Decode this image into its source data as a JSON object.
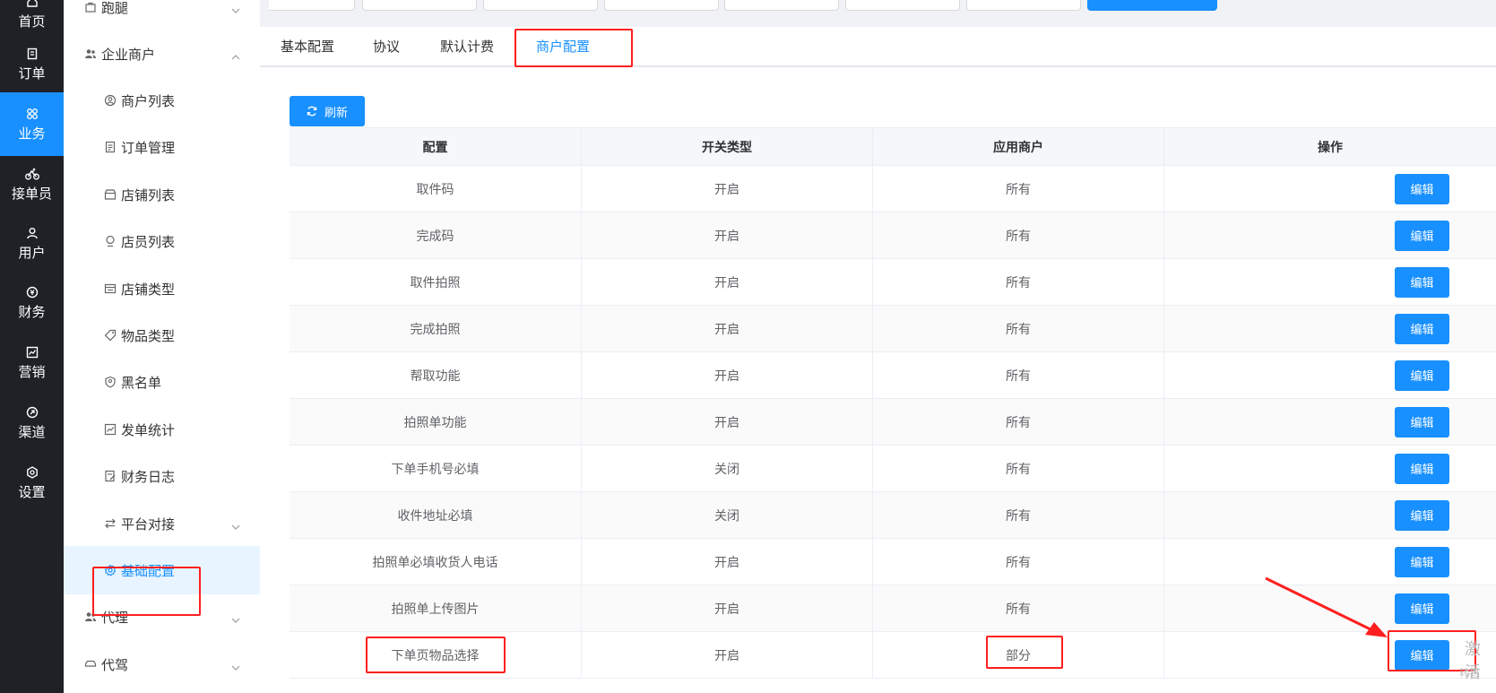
{
  "rail": {
    "items": [
      {
        "label": "首页",
        "icon": "home-icon"
      },
      {
        "label": "订单",
        "icon": "order-icon"
      },
      {
        "label": "业务",
        "icon": "grid-icon",
        "active": true
      },
      {
        "label": "接单员",
        "icon": "bike-icon"
      },
      {
        "label": "用户",
        "icon": "user-icon"
      },
      {
        "label": "财务",
        "icon": "money-icon"
      },
      {
        "label": "营销",
        "icon": "chart-icon"
      },
      {
        "label": "渠道",
        "icon": "link-icon"
      },
      {
        "label": "设置",
        "icon": "gear-icon"
      }
    ]
  },
  "submenu": {
    "items": [
      {
        "label": "跑腿",
        "type": "group",
        "icon": "bag-icon",
        "chev": "down"
      },
      {
        "label": "企业商户",
        "type": "group",
        "icon": "users-icon",
        "chev": "up"
      },
      {
        "label": "商户列表",
        "type": "child",
        "icon": "user-circle-icon"
      },
      {
        "label": "订单管理",
        "type": "child",
        "icon": "document-icon"
      },
      {
        "label": "店铺列表",
        "type": "child",
        "icon": "shop-icon"
      },
      {
        "label": "店员列表",
        "type": "child",
        "icon": "location-icon"
      },
      {
        "label": "店铺类型",
        "type": "child",
        "icon": "list-icon"
      },
      {
        "label": "物品类型",
        "type": "child",
        "icon": "tag-icon"
      },
      {
        "label": "黑名单",
        "type": "child",
        "icon": "shield-icon"
      },
      {
        "label": "发单统计",
        "type": "child",
        "icon": "trend-icon"
      },
      {
        "label": "财务日志",
        "type": "child",
        "icon": "edit-document-icon"
      },
      {
        "label": "平台对接",
        "type": "child",
        "icon": "switch-icon",
        "chev": "down"
      },
      {
        "label": "基础配置",
        "type": "child",
        "icon": "gear-icon",
        "active": true
      },
      {
        "label": "代理",
        "type": "group",
        "icon": "users-icon",
        "chev": "down"
      },
      {
        "label": "代驾",
        "type": "group",
        "icon": "car-icon",
        "chev": "down"
      }
    ]
  },
  "tabs": {
    "items": [
      {
        "label": "基本配置"
      },
      {
        "label": "协议"
      },
      {
        "label": "默认计费"
      },
      {
        "label": "商户配置",
        "active": true
      }
    ]
  },
  "toolbar": {
    "refresh_label": "刷新"
  },
  "table": {
    "headers": [
      "配置",
      "开关类型",
      "应用商户",
      "操作"
    ],
    "edit_label": "编辑",
    "rows": [
      {
        "config": "取件码",
        "switch": "开启",
        "merchant": "所有"
      },
      {
        "config": "完成码",
        "switch": "开启",
        "merchant": "所有"
      },
      {
        "config": "取件拍照",
        "switch": "开启",
        "merchant": "所有"
      },
      {
        "config": "完成拍照",
        "switch": "开启",
        "merchant": "所有"
      },
      {
        "config": "帮取功能",
        "switch": "开启",
        "merchant": "所有"
      },
      {
        "config": "拍照单功能",
        "switch": "开启",
        "merchant": "所有"
      },
      {
        "config": "下单手机号必填",
        "switch": "关闭",
        "merchant": "所有"
      },
      {
        "config": "收件地址必填",
        "switch": "关闭",
        "merchant": "所有"
      },
      {
        "config": "拍照单必填收货人电话",
        "switch": "开启",
        "merchant": "所有"
      },
      {
        "config": "拍照单上传图片",
        "switch": "开启",
        "merchant": "所有"
      },
      {
        "config": "下单页物品选择",
        "switch": "开启",
        "merchant": "部分"
      }
    ]
  },
  "colors": {
    "accent": "#1890ff",
    "annotation": "#ff1f1f"
  },
  "watermark": {
    "line1": "激活",
    "line2": "转到"
  }
}
